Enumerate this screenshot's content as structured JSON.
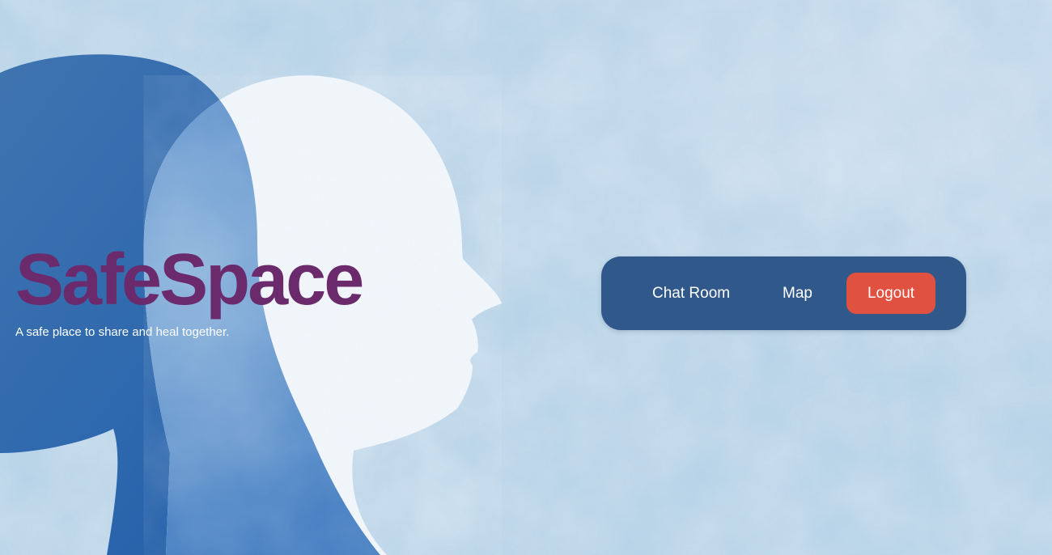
{
  "brand": {
    "title": "SafeSpace",
    "tagline": "A safe place to share and heal together."
  },
  "nav": {
    "chat_room": "Chat Room",
    "map": "Map",
    "logout": "Logout"
  },
  "colors": {
    "background": "#b3d0e6",
    "title": "#6a2a6c",
    "nav_bg": "#31588a",
    "logout_bg": "#e0513f"
  },
  "illustration": {
    "icon": "two-heads-silhouette-icon"
  }
}
